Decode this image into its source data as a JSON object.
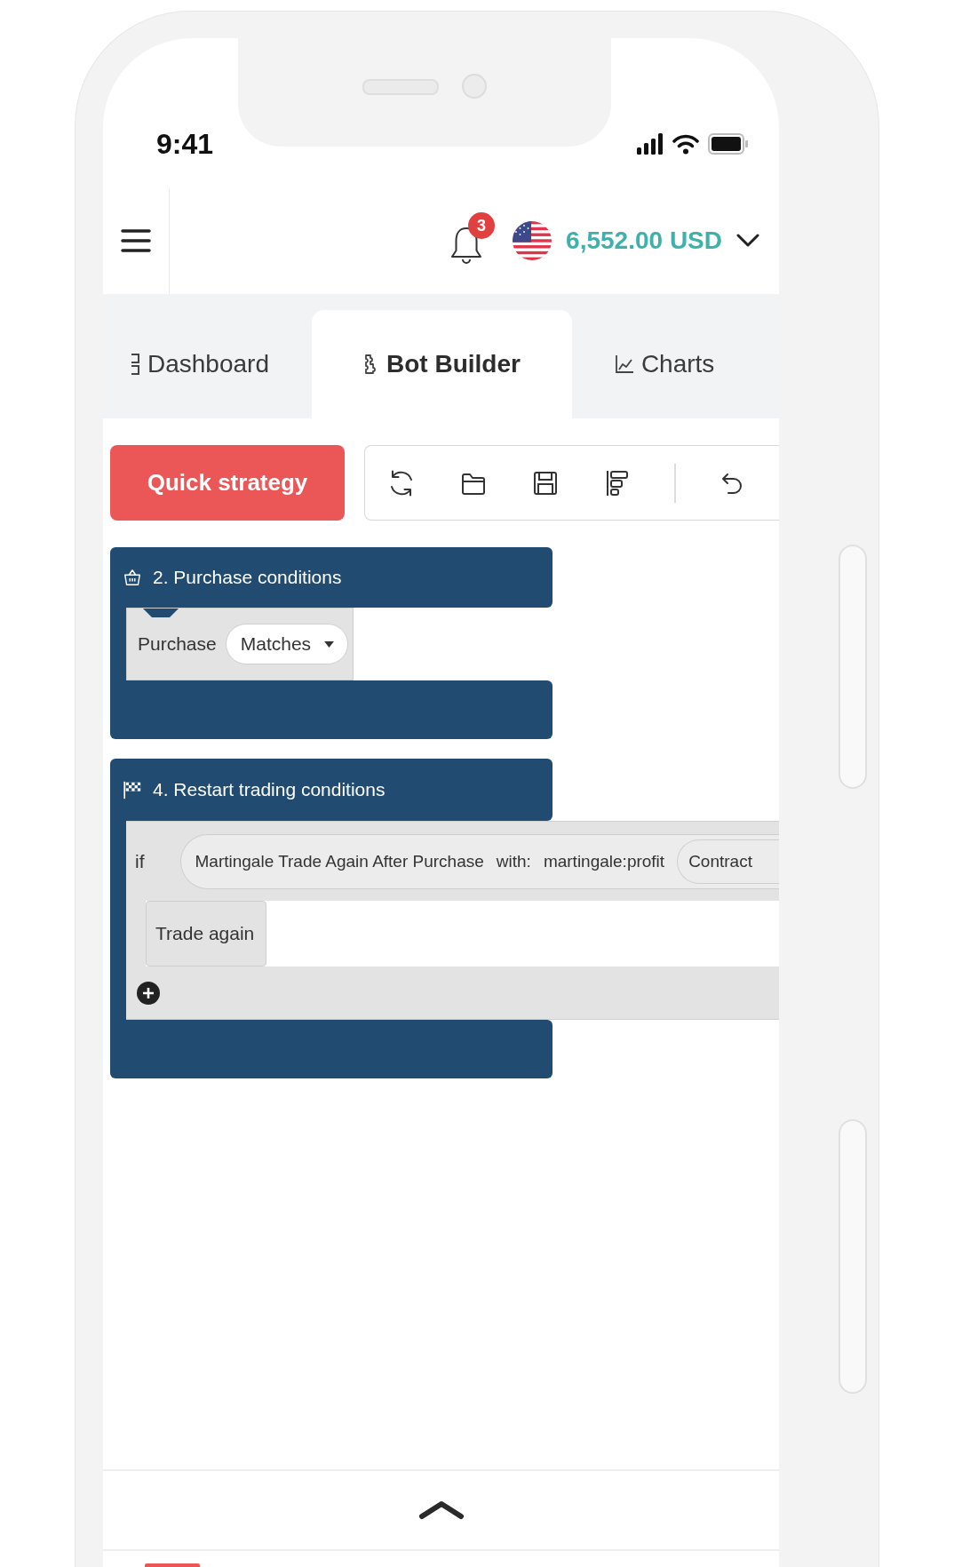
{
  "status_bar": {
    "time": "9:41"
  },
  "header": {
    "notification_count": "3",
    "balance": "6,552.00 USD"
  },
  "tabs": [
    {
      "label": "Dashboard",
      "selected": false
    },
    {
      "label": "Bot Builder",
      "selected": true
    },
    {
      "label": "Charts",
      "selected": false
    }
  ],
  "toolbar": {
    "quick_strategy": "Quick strategy"
  },
  "blocks": [
    {
      "kind": "purchase",
      "title": "2. Purchase conditions",
      "label": "Purchase",
      "dropdown": "Matches"
    },
    {
      "kind": "restart",
      "title": "4. Restart trading conditions",
      "keyword": "if",
      "condition": {
        "name": "Martingale Trade Again After Purchase",
        "parameter_label": "with:",
        "parameter_value": "martingale:profit",
        "input": "Contract"
      },
      "statement": "Trade again"
    }
  ]
}
